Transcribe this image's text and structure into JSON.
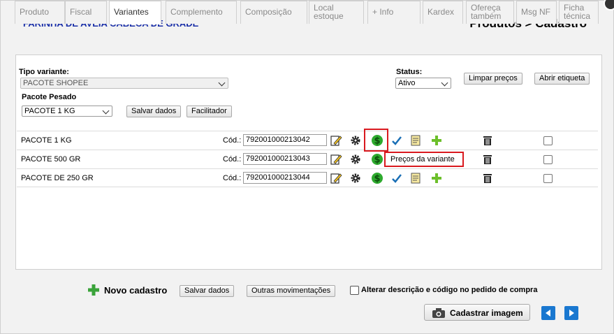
{
  "header": {
    "product_name": "FARINHA DE AVEIA CABECA DE GRADE",
    "page_title": "Produtos > Cadastro"
  },
  "tabs": [
    {
      "label": "Produto",
      "active": false
    },
    {
      "label": "Fiscal",
      "active": false
    },
    {
      "label": "Variantes",
      "active": true
    },
    {
      "label": "Complemento",
      "active": false
    },
    {
      "label": "Composição",
      "active": false
    },
    {
      "label": "Local estoque",
      "active": false
    },
    {
      "label": "+ Info",
      "active": false
    },
    {
      "label": "Kardex",
      "active": false
    },
    {
      "label": "Ofereça também",
      "active": false
    },
    {
      "label": "Msg NF",
      "active": false
    },
    {
      "label": "Ficha técnica",
      "active": false
    }
  ],
  "form": {
    "tipo_variante_label": "Tipo variante:",
    "tipo_variante_value": "PACOTE SHOPEE",
    "status_label": "Status:",
    "status_value": "Ativo",
    "limpar_precos_label": "Limpar preços",
    "abrir_etiqueta_label": "Abrir etiqueta",
    "pacote_pesado_label": "Pacote Pesado",
    "pacote_pesado_value": "PACOTE 1 KG",
    "salvar_dados_label": "Salvar dados",
    "facilitador_label": "Facilitador"
  },
  "variants": [
    {
      "name": "PACOTE 1 KG",
      "cod_label": "Cód.:",
      "code": "792001000213042"
    },
    {
      "name": "PACOTE 500 GR",
      "cod_label": "Cód.:",
      "code": "792001000213043"
    },
    {
      "name": "PACOTE DE 250 GR",
      "cod_label": "Cód.:",
      "code": "792001000213044"
    }
  ],
  "tooltip": {
    "text": "Preços da variante"
  },
  "footer": {
    "novo_cadastro_label": "Novo cadastro",
    "salvar_dados_label": "Salvar dados",
    "outras_movimentacoes_label": "Outras movimentações",
    "alterar_label": "Alterar descrição e código no pedido de compra",
    "cadastrar_imagem_label": "Cadastrar imagem"
  },
  "colors": {
    "title_blue": "#1a2fa8",
    "highlight_red": "#d9191f",
    "nav_blue": "#1a78d0",
    "dollar_green": "#2eaa2e"
  },
  "icons": [
    "edit-icon",
    "gear-icon",
    "dollar-icon",
    "check-icon",
    "note-icon",
    "plus-icon",
    "trash-icon",
    "camera-icon",
    "arrow-left-icon",
    "arrow-right-icon"
  ]
}
